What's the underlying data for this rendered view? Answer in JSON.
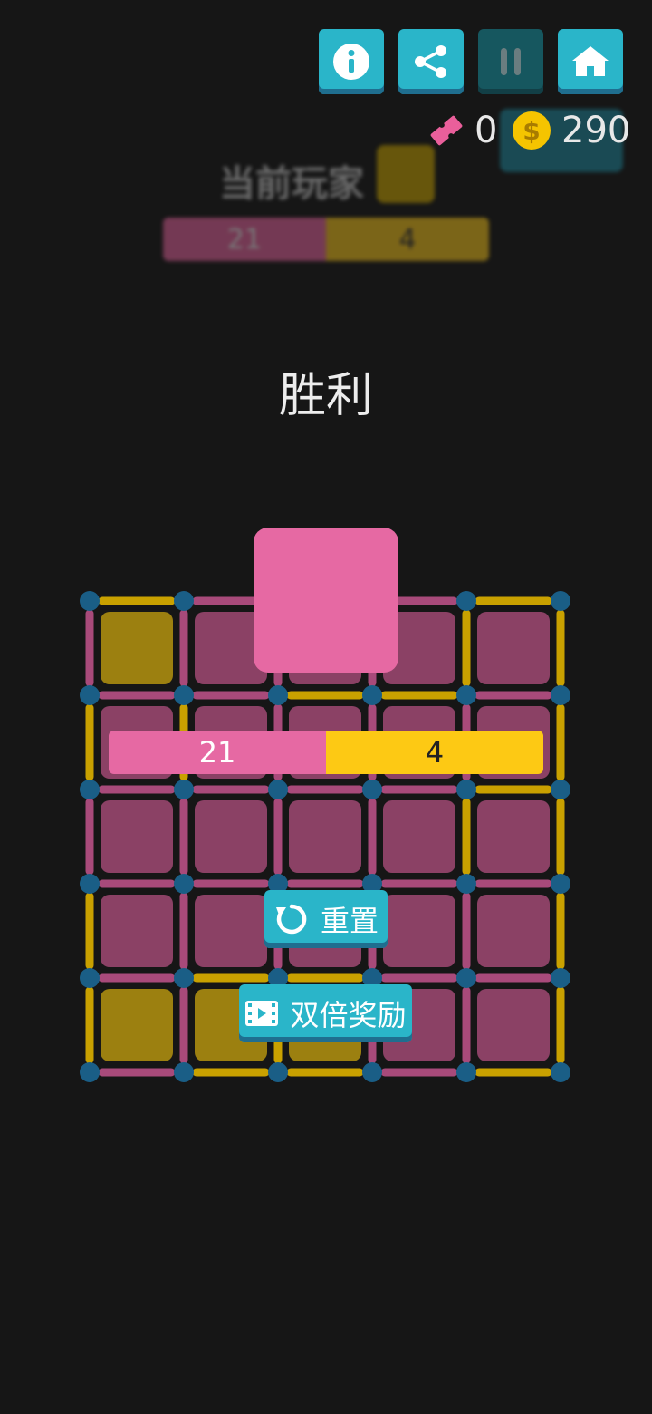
{
  "toolbar": {
    "info_icon": "info-icon",
    "share_icon": "share-icon",
    "pause_icon": "pause-icon",
    "home_icon": "home-icon"
  },
  "currency": {
    "tickets": "0",
    "coins": "290",
    "coin_symbol": "$"
  },
  "background_hud": {
    "current_player_label": "当前玩家",
    "score_pink": "21",
    "score_yellow": "4"
  },
  "result": {
    "title": "胜利"
  },
  "scores": {
    "pink": "21",
    "yellow": "4"
  },
  "buttons": {
    "reset_label": "重置",
    "double_reward_label": "双倍奖励"
  },
  "colors": {
    "pink": "#e669a3",
    "yellow": "#fdc914",
    "teal": "#2ab5c9",
    "dot": "#1a5e86",
    "background": "#161616"
  },
  "board": {
    "rows": 5,
    "cols": 5,
    "cells": [
      [
        "y",
        "p",
        "p",
        "p",
        "p"
      ],
      [
        "p",
        "p",
        "p",
        "p",
        "p"
      ],
      [
        "p",
        "p",
        "p",
        "p",
        "p"
      ],
      [
        "p",
        "p",
        "p",
        "p",
        "p"
      ],
      [
        "y",
        "y",
        "y",
        "p",
        "p"
      ]
    ],
    "h_edges": [
      [
        "y",
        "p",
        "p",
        "p",
        "y"
      ],
      [
        "p",
        "p",
        "y",
        "y",
        "p"
      ],
      [
        "p",
        "p",
        "p",
        "p",
        "y"
      ],
      [
        "p",
        "p",
        "p",
        "p",
        "p"
      ],
      [
        "p",
        "y",
        "y",
        "p",
        "p"
      ],
      [
        "p",
        "y",
        "y",
        "p",
        "y"
      ]
    ],
    "v_edges": [
      [
        "p",
        "p",
        "p",
        "p",
        "y",
        "y"
      ],
      [
        "y",
        "y",
        "p",
        "p",
        "p",
        "y"
      ],
      [
        "p",
        "p",
        "p",
        "p",
        "y",
        "y"
      ],
      [
        "y",
        "p",
        "p",
        "p",
        "p",
        "y"
      ],
      [
        "y",
        "p",
        "y",
        "p",
        "p",
        "y"
      ]
    ]
  }
}
